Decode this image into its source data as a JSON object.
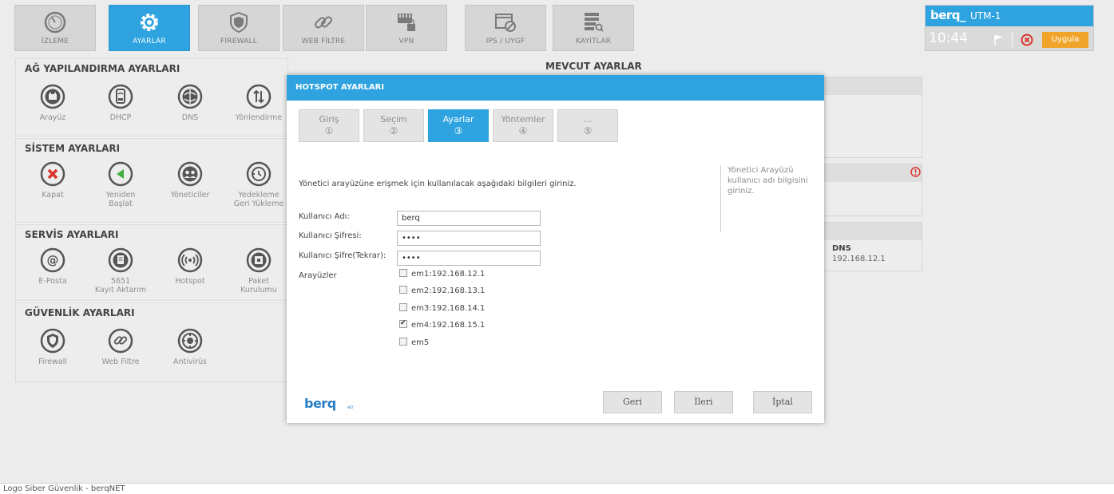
{
  "nav": {
    "items": [
      {
        "label": "İZLEME",
        "icon": "gauge-icon"
      },
      {
        "label": "AYARLAR",
        "icon": "gear-icon"
      },
      {
        "label": "FIREWALL",
        "icon": "shield-icon"
      },
      {
        "label": "WEB FİLTRE",
        "icon": "link-icon"
      },
      {
        "label": "VPN",
        "icon": "vpn-lock-icon"
      },
      {
        "label": "IPS / UYGF",
        "icon": "blocked-window-icon"
      },
      {
        "label": "KAYITLAR",
        "icon": "log-search-icon"
      }
    ],
    "active_index": 1
  },
  "device": {
    "logo": "berq_",
    "name": "UTM-1",
    "clock": "10:44",
    "apply_label": "Uygula"
  },
  "sections": [
    {
      "title": "AĞ YAPILANDIRMA AYARLARI",
      "items": [
        {
          "label": "Arayüz",
          "label2": "",
          "icon": "interface-icon"
        },
        {
          "label": "DHCP",
          "label2": "",
          "icon": "dhcp-icon"
        },
        {
          "label": "DNS",
          "label2": "",
          "icon": "dns-icon"
        },
        {
          "label": "Yönlendirme",
          "label2": "",
          "icon": "routing-icon"
        }
      ]
    },
    {
      "title": "SİSTEM AYARLARI",
      "items": [
        {
          "label": "Kapat",
          "label2": "",
          "icon": "shutdown-icon"
        },
        {
          "label": "Yeniden",
          "label2": "Başlat",
          "icon": "restart-icon"
        },
        {
          "label": "Yöneticiler",
          "label2": "",
          "icon": "admins-icon"
        },
        {
          "label": "Yedekleme",
          "label2": "Geri Yükleme",
          "icon": "backup-icon"
        }
      ]
    },
    {
      "title": "SERVİS AYARLARI",
      "items": [
        {
          "label": "E-Posta",
          "label2": "",
          "icon": "email-icon"
        },
        {
          "label": "5651",
          "label2": "Kayıt Aktarım",
          "icon": "log-transfer-icon"
        },
        {
          "label": "Hotspot",
          "label2": "",
          "icon": "hotspot-icon"
        },
        {
          "label": "Paket",
          "label2": "Kurulumu",
          "icon": "package-icon"
        }
      ]
    },
    {
      "title": "GÜVENLİK AYARLARI",
      "items": [
        {
          "label": "Firewall",
          "label2": "",
          "icon": "firewall-icon"
        },
        {
          "label": "Web Filtre",
          "label2": "",
          "icon": "web-filter-icon"
        },
        {
          "label": "Antivirüs",
          "label2": "",
          "icon": "antivirus-icon"
        }
      ]
    }
  ],
  "current": {
    "title": "MEVCUT AYARLAR",
    "dns_label": "DNS",
    "dns_value": "192.168.12.1"
  },
  "modal": {
    "title": "HOTSPOT AYARLARI",
    "steps": [
      {
        "label": "Giriş",
        "num": "①"
      },
      {
        "label": "Seçim",
        "num": "②"
      },
      {
        "label": "Ayarlar",
        "num": "③"
      },
      {
        "label": "Yöntemler",
        "num": "④"
      },
      {
        "label": "...",
        "num": "⑤"
      }
    ],
    "active_step": 2,
    "intro": "Yönetici arayüzüne erişmek için kullanılacak aşağıdaki bilgileri giriniz.",
    "hint": "Yönetici Arayüzü kullanıcı adı bilgisini giriniz.",
    "username_label": "Kullanıcı Adı:",
    "username_value": "berq",
    "password_label": "Kullanıcı Şifresi:",
    "password_value": "••••",
    "password2_label": "Kullanıcı Şifre(Tekrar):",
    "password2_value": "••••",
    "interfaces_label": "Arayüzler",
    "interfaces": [
      {
        "label": "em1:192.168.12.1",
        "checked": false
      },
      {
        "label": "em2:192.168.13.1",
        "checked": false
      },
      {
        "label": "em3:192.168.14.1",
        "checked": false
      },
      {
        "label": "em4:192.168.15.1",
        "checked": true
      },
      {
        "label": "em5",
        "checked": false
      }
    ],
    "logo": "berq",
    "logo_sub": "NET",
    "back_label": "Geri",
    "next_label": "İleri",
    "cancel_label": "İptal"
  },
  "footer": {
    "text": "Logo Siber Güvenlik - berqNET"
  },
  "colors": {
    "accent": "#2ea3e0",
    "apply": "#f0a52a",
    "danger": "#d9342b"
  }
}
